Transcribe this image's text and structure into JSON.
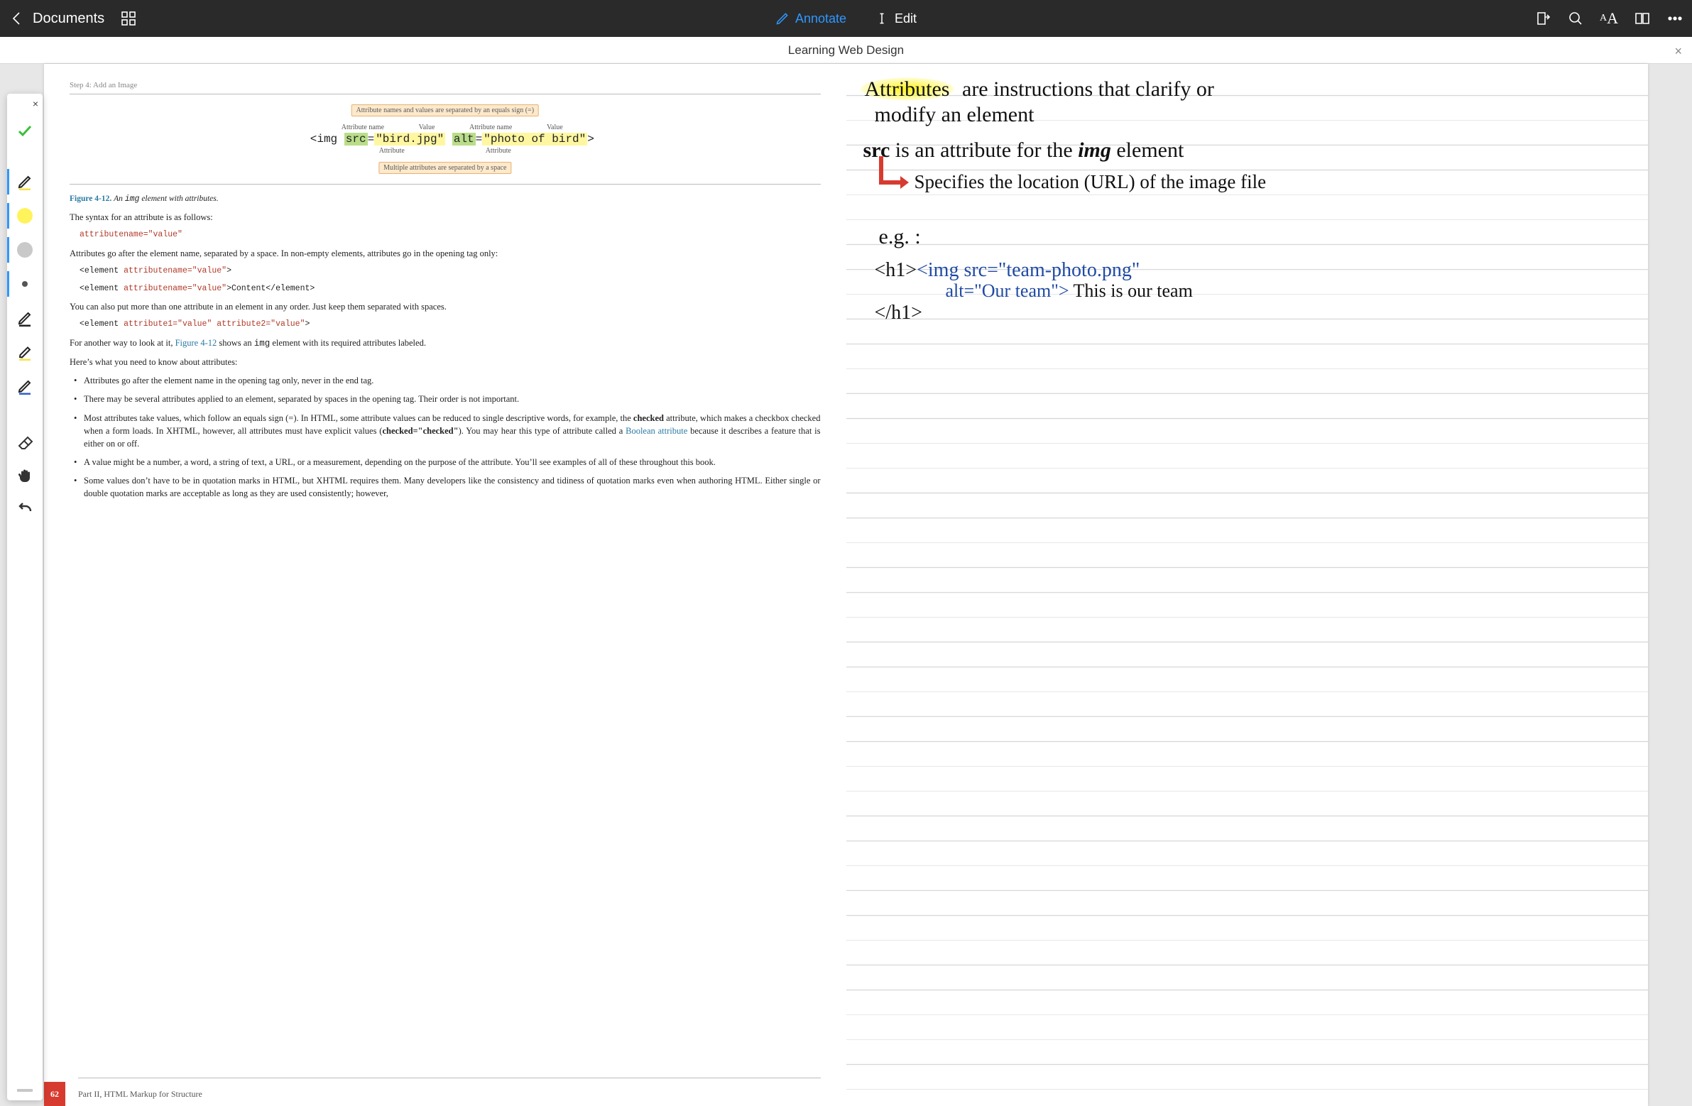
{
  "topbar": {
    "back_label": "Documents",
    "annotate_label": "Annotate",
    "edit_label": "Edit"
  },
  "titlebar": {
    "title": "Learning Web Design",
    "close_glyph": "×"
  },
  "palette": {
    "close_glyph": "×",
    "tools": [
      {
        "id": "confirm",
        "name": "confirm-icon"
      },
      {
        "id": "pen-black",
        "name": "pen-black-icon"
      },
      {
        "id": "swatch-yellow",
        "name": "color-yellow"
      },
      {
        "id": "swatch-gray",
        "name": "color-gray"
      },
      {
        "id": "swatch-dot",
        "name": "brush-size-dot"
      },
      {
        "id": "pencil",
        "name": "pencil-icon"
      },
      {
        "id": "highlighter",
        "name": "highlighter-icon"
      },
      {
        "id": "pen-blue",
        "name": "pen-blue-icon"
      },
      {
        "id": "eraser",
        "name": "eraser-icon"
      },
      {
        "id": "hand",
        "name": "hand-icon"
      },
      {
        "id": "undo",
        "name": "undo-icon"
      }
    ]
  },
  "book": {
    "running_head": "Step 4: Add an Image",
    "diagram": {
      "top_callout": "Attribute names and values are separated by an equals sign (=)",
      "label_attrname": "Attribute name",
      "label_value": "Value",
      "code_prefix": "<img ",
      "attr1_name": "src",
      "eq": "=",
      "attr1_value": "\"bird.jpg\"",
      "attr2_name": "alt",
      "attr2_value": "\"photo of bird\"",
      "code_suffix": ">",
      "under_label": "Attribute",
      "bottom_callout": "Multiple attributes are separated by a space"
    },
    "figcap_num": "Figure 4-12.",
    "figcap_text_a": "An ",
    "figcap_mono": "img",
    "figcap_text_b": " element with attributes.",
    "p_syntax": "The syntax for an attribute is as follows:",
    "pre1": "attributename=\"value\"",
    "p_afterelem": "Attributes go after the element name, separated by a space. In non-empty elements, attributes go in the opening tag only:",
    "pre2_a": "<element ",
    "pre2_b": "attributename=\"value\"",
    "pre2_c": ">",
    "pre3_a": "<element ",
    "pre3_b": "attributename=\"value\"",
    "pre3_c": ">Content</element>",
    "p_multi": "You can also put more than one attribute in an element in any order. Just keep them separated with spaces.",
    "pre4_a": "<element ",
    "pre4_b": "attribute1=\"value\"",
    "pre4_sp": " ",
    "pre4_c": "attribute2=\"value\"",
    "pre4_d": ">",
    "p_another_a": "For another way to look at it, ",
    "p_another_link": "Figure 4-12",
    "p_another_b": " shows an ",
    "p_another_mono": "img",
    "p_another_c": " element with its required attributes labeled.",
    "p_heres": "Here’s what you need to know about attributes:",
    "bullets": [
      "Attributes go after the element name in the opening tag only, never in the end tag.",
      "There may be several attributes applied to an element, separated by spaces in the opening tag. Their order is not important."
    ],
    "b3_a": "Most attributes take values, which follow an equals sign (=). In HTML, some attribute values can be reduced to single descriptive words, for example, the ",
    "b3_bold1": "checked",
    "b3_b": " attribute, which makes a checkbox checked when a form loads. In XHTML, however, all attributes must have explicit values (",
    "b3_bold2": "checked=\"checked\"",
    "b3_c": "). You may hear this type of attribute called a ",
    "b3_link": "Boolean attribute",
    "b3_d": " because it describes a feature that is either on or off.",
    "b4": "A value might be a number, a word, a string of text, a URL, or a measurement, depending on the purpose of the attribute. You’ll see examples of all of these throughout this book.",
    "b5": "Some values don’t have to be in quotation marks in HTML, but XHTML requires them. Many developers like the consistency and tidiness of quotation marks even when authoring HTML. Either single or double quotation marks are acceptable as long as they are used consistently; however,",
    "page_number": "62",
    "part_label": "Part  II, HTML Markup for Structure"
  },
  "notes": {
    "line1_hi": "Attributes",
    "line1_rest": " are instructions that clarify or",
    "line2": "modify an element",
    "line3_a": "src",
    "line3_b": " is an attribute for the ",
    "line3_c": "img",
    "line3_d": " element",
    "line4": "Specifies the location (URL) of the image file",
    "line5": "e.g. :",
    "code1": "<h1>",
    "code_blue1": "<img src=\"team-photo.png\"",
    "code_blue2": "alt=\"Our team\">",
    "code_tail": "This is our team",
    "code2": "</h1>"
  }
}
